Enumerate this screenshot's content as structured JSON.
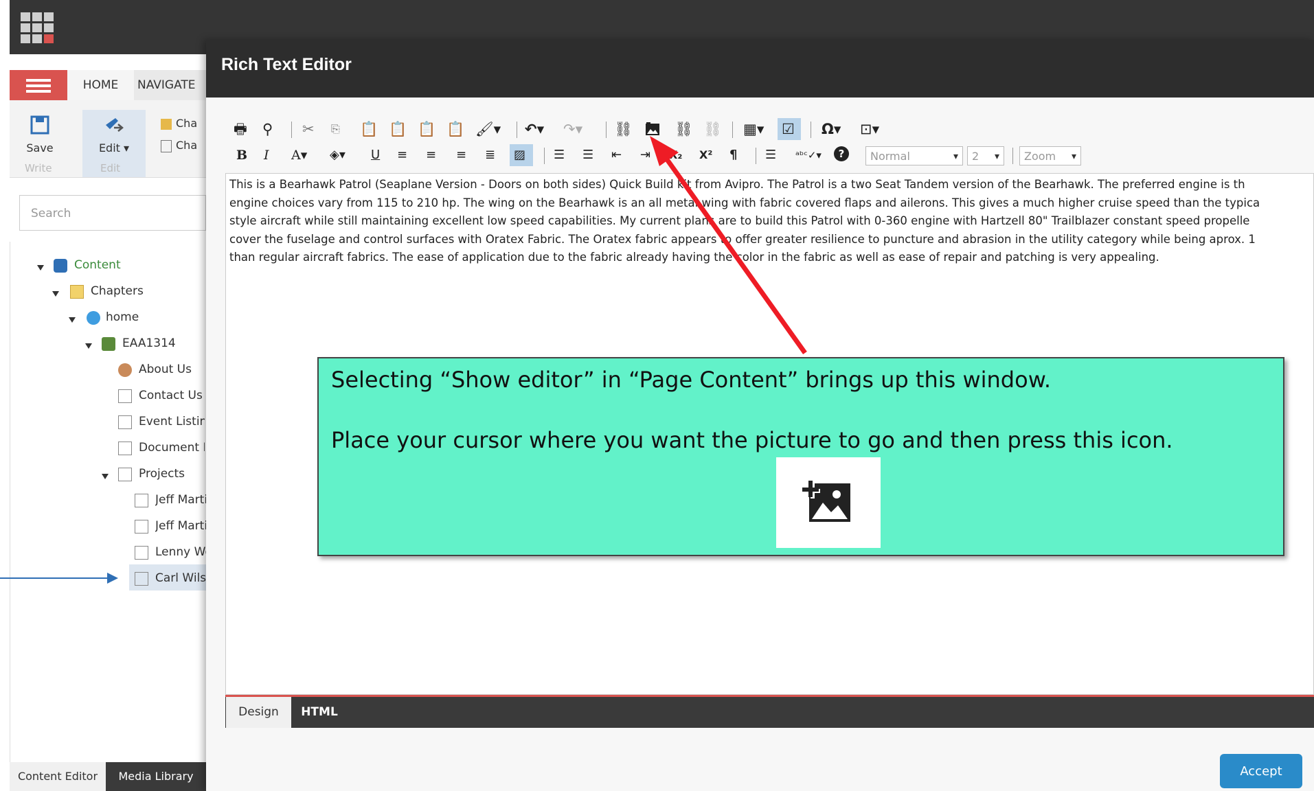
{
  "shell": {
    "ribbon": {
      "menu_icon": "hamburger-icon",
      "tab_home": "HOME",
      "tab_navigate": "NAVIGATE",
      "save_label": "Save",
      "edit_label": "Edit ▾",
      "write_caption": "Write",
      "edit_caption": "Edit",
      "ribbon_item_1": "Cha",
      "ribbon_item_2": "Cha"
    },
    "search_placeholder": "Search",
    "tree": [
      {
        "label": "Content",
        "icon": "content-icon"
      },
      {
        "label": "Chapters",
        "icon": "folder-icon"
      },
      {
        "label": "home",
        "icon": "globe-icon"
      },
      {
        "label": "EAA1314",
        "icon": "site-icon"
      },
      {
        "label": "About Us",
        "icon": "people-icon"
      },
      {
        "label": "Contact Us",
        "icon": "envelope-icon"
      },
      {
        "label": "Event Listing",
        "icon": "page-icon"
      },
      {
        "label": "Document L",
        "icon": "page-icon"
      },
      {
        "label": "Projects",
        "icon": "page-icon"
      },
      {
        "label": "Jeff Marti",
        "icon": "page-icon"
      },
      {
        "label": "Jeff Marti",
        "icon": "page-icon"
      },
      {
        "label": "Lenny We",
        "icon": "page-icon"
      },
      {
        "label": "Carl Wilso",
        "icon": "page-icon"
      }
    ],
    "bottom_tabs": {
      "content_editor": "Content Editor",
      "media_library": "Media Library"
    }
  },
  "dialog": {
    "title": "Rich Text Editor",
    "toolbar_row1_icons": [
      "print-icon",
      "find-icon",
      "cut-icon",
      "copy-icon",
      "paste-icon",
      "paste-word-icon",
      "paste-word-clean-icon",
      "paste-plain-icon",
      "format-stripper-icon",
      "undo-icon",
      "redo-icon",
      "insert-link-icon",
      "insert-image-icon",
      "link-manager-icon",
      "remove-link-icon",
      "table-icon",
      "spellcheck-view-icon",
      "symbol-icon",
      "template-icon"
    ],
    "toolbar_row2_icons": [
      "bold-icon",
      "italic-icon",
      "font-color-icon",
      "highlight-icon",
      "underline-icon",
      "align-left-icon",
      "align-center-icon",
      "align-right-icon",
      "justify-icon",
      "clear-format-icon",
      "ordered-list-icon",
      "unordered-list-icon",
      "outdent-icon",
      "indent-icon",
      "subscript-icon",
      "superscript-icon",
      "paragraph-icon",
      "line-icon",
      "spell-icon",
      "help-icon"
    ],
    "format_select": "Normal",
    "size_select": "2",
    "zoom_select": "Zoom",
    "editor_lines": [
      "This is a Bearhawk Patrol (Seaplane Version - Doors on both sides) Quick Build kit from Avipro.  The Patrol is a two Seat Tandem version of the Bearhawk. The preferred engine is th",
      "engine choices vary from 115 to 210 hp. The wing on the Bearhawk is an all metal wing with fabric covered flaps and ailerons.  This gives a much higher cruise speed than the typica",
      "style aircraft while still maintaining excellent low speed capabilities.  My current plans are to build this Patrol with 0-360 engine with Hartzell 80\" Trailblazer constant speed propelle",
      "cover the fuselage and control surfaces with Oratex Fabric. The Oratex fabric appears to offer greater resilience to puncture and abrasion in the utility category while being aprox. 1",
      "than regular aircraft fabrics.  The ease of application due to the fabric already having the color in the fabric as well as ease of repair and patching is very appealing."
    ],
    "mode_design": "Design",
    "mode_html": "HTML",
    "accept_label": "Accept"
  },
  "callout": {
    "line1": "Selecting “Show editor” in “Page Content” brings up this window.",
    "line2": "Place your cursor where you want the picture to go and then press this icon.",
    "icon": "insert-image-icon",
    "color": "#62f2c9"
  },
  "annotation_colors": {
    "red_arrow": "#ee1c25",
    "blue_arrow": "#2f6fb5"
  }
}
